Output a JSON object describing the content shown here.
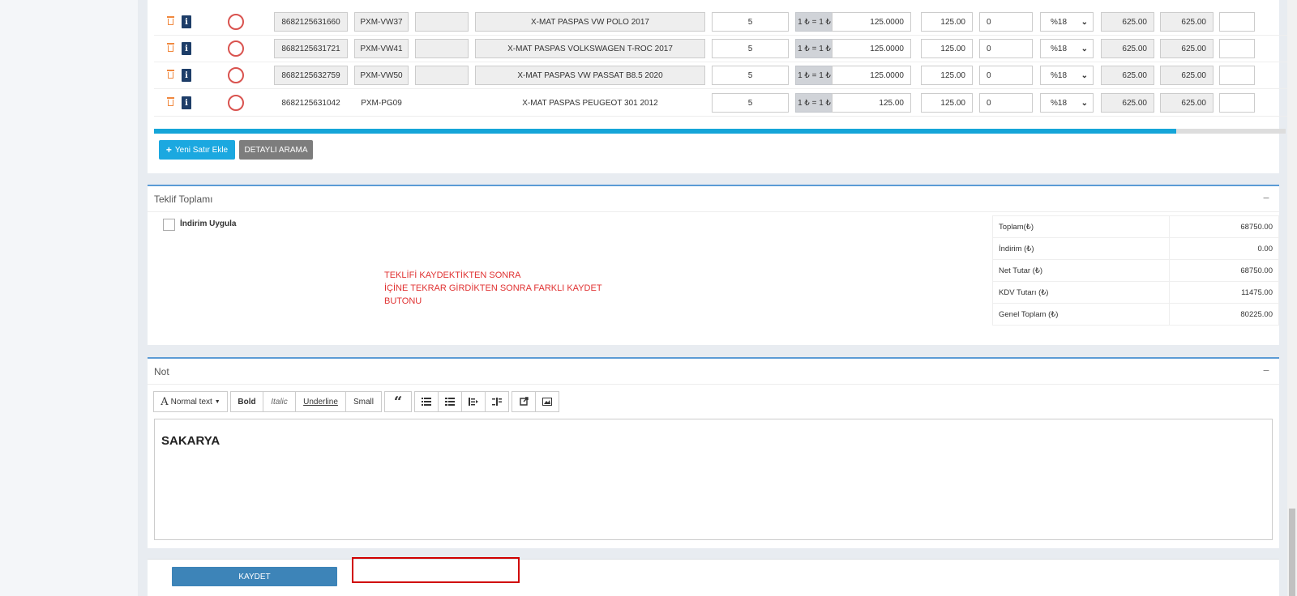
{
  "products": [
    {
      "barcode": "8682125631660",
      "code": "PXM-VW37",
      "name": "X-MAT PASPAS VW POLO 2017",
      "qty": "5",
      "rate": "1 ₺ = 1 ₺",
      "price": "125.0000",
      "unit_total": "125.00",
      "discount": "0",
      "vat": "%18",
      "total": "625.00",
      "grand": "625.00",
      "boxed": true
    },
    {
      "barcode": "8682125631721",
      "code": "PXM-VW41",
      "name": "X-MAT PASPAS VOLKSWAGEN T-ROC 2017",
      "qty": "5",
      "rate": "1 ₺ = 1 ₺",
      "price": "125.0000",
      "unit_total": "125.00",
      "discount": "0",
      "vat": "%18",
      "total": "625.00",
      "grand": "625.00",
      "boxed": true
    },
    {
      "barcode": "8682125632759",
      "code": "PXM-VW50",
      "name": "X-MAT PASPAS VW PASSAT B8.5 2020",
      "qty": "5",
      "rate": "1 ₺ = 1 ₺",
      "price": "125.0000",
      "unit_total": "125.00",
      "discount": "0",
      "vat": "%18",
      "total": "625.00",
      "grand": "625.00",
      "boxed": true
    },
    {
      "barcode": "8682125631042",
      "code": "PXM-PG09",
      "name": "X-MAT PASPAS PEUGEOT 301 2012",
      "qty": "5",
      "rate": "1 ₺ = 1 ₺",
      "price": "125.00",
      "unit_total": "125.00",
      "discount": "0",
      "vat": "%18",
      "total": "625.00",
      "grand": "625.00",
      "boxed": false
    }
  ],
  "table_scroll_progress": 0.903,
  "actions": {
    "new_row": "Yeni Satır Ekle",
    "detailed_search": "DETAYLI ARAMA"
  },
  "totals_panel": {
    "title": "Teklif Toplamı",
    "collapse": "−",
    "discount_label": "İndirim Uygula",
    "note_lines": [
      "TEKLİFİ KAYDEKTİKTEN SONRA",
      "İÇİNE TEKRAR GİRDİKTEN SONRA FARKLI KAYDET",
      "BUTONU"
    ],
    "rows": [
      {
        "label": "Toplam(₺)",
        "value": "68750.00"
      },
      {
        "label": "İndirim (₺)",
        "value": "0.00"
      },
      {
        "label": "Net Tutar (₺)",
        "value": "68750.00"
      },
      {
        "label": "KDV Tutarı (₺)",
        "value": "11475.00"
      },
      {
        "label": "Genel Toplam (₺)",
        "value": "80225.00"
      }
    ]
  },
  "note_panel": {
    "title": "Not",
    "collapse": "−",
    "toolbar": {
      "font": "Normal text",
      "bold": "Bold",
      "italic": "Italic",
      "underline": "Underline",
      "small": "Small",
      "quote": "“"
    },
    "content": "SAKARYA"
  },
  "save_label": "KAYDET",
  "colors": {
    "accent": "#15a5d8",
    "save": "#3d84b8",
    "danger": "#d9534f",
    "info": "#1d3d68",
    "annotation": "#e03131"
  }
}
